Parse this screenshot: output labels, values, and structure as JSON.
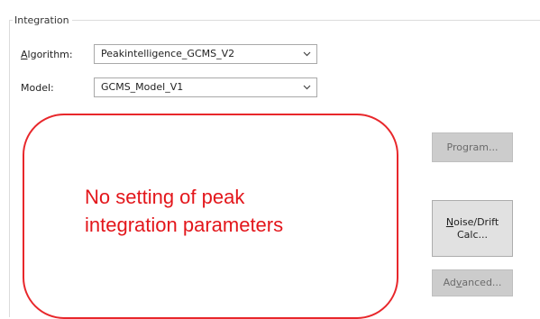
{
  "integration": {
    "group_title": "Integration",
    "algorithm": {
      "label_mnemonic": "A",
      "label_rest": "lgorithm:",
      "value": "Peakintelligence_GCMS_V2"
    },
    "model": {
      "label": "Model:",
      "value": "GCMS_Model_V1"
    }
  },
  "buttons": {
    "program": "Program...",
    "noise_drift_mnemonic": "N",
    "noise_drift_line1_rest": "oise/Drift",
    "noise_drift_line2": "Calc...",
    "advanced_before": "Ad",
    "advanced_mnemonic": "v",
    "advanced_after": "anced..."
  },
  "annotation": {
    "line1": "No setting of peak",
    "line2": "integration parameters"
  },
  "colors": {
    "annotation_red": "#e3161b",
    "button_gray": "#e1e1e1",
    "disabled_button_gray": "#cccccc"
  },
  "icons": {
    "combo_arrow": "chevron-down-icon"
  }
}
